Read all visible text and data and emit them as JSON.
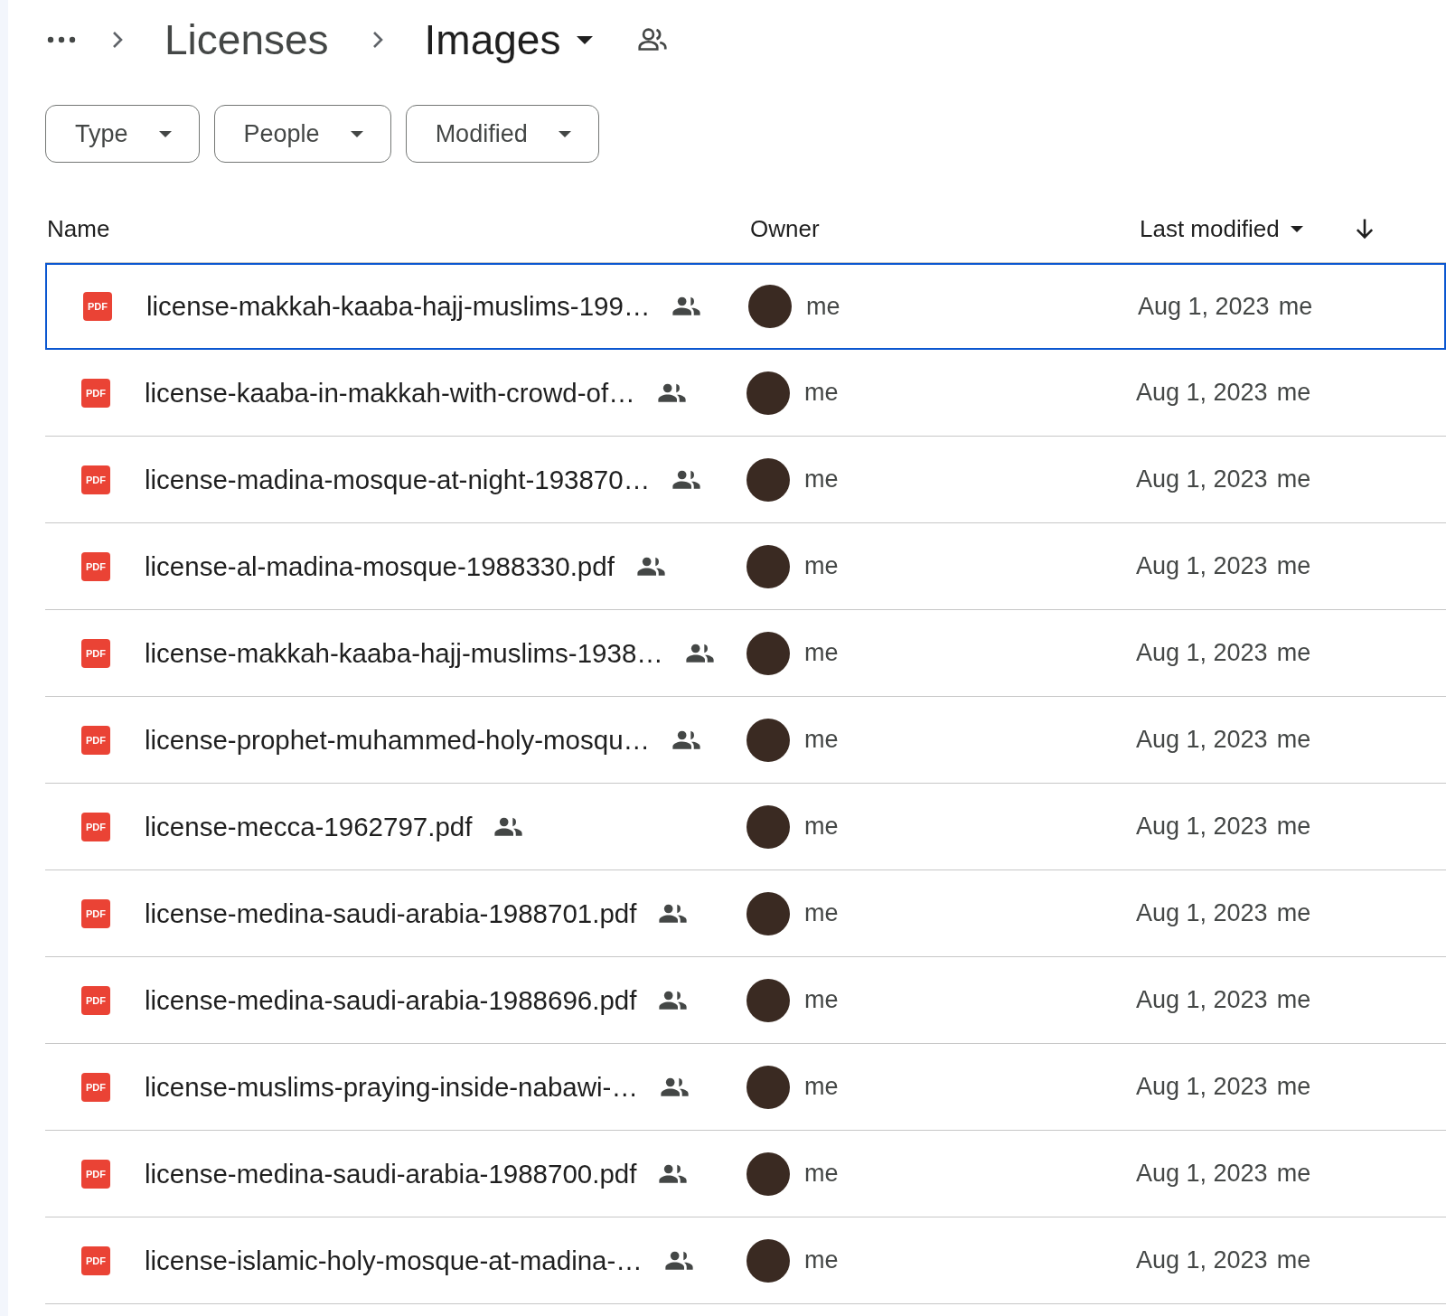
{
  "breadcrumb": {
    "items": [
      {
        "label": "Licenses"
      },
      {
        "label": "Images"
      }
    ]
  },
  "filters": [
    {
      "label": "Type"
    },
    {
      "label": "People"
    },
    {
      "label": "Modified"
    }
  ],
  "table": {
    "columns": [
      {
        "label": "Name"
      },
      {
        "label": "Owner"
      },
      {
        "label": "Last modified"
      }
    ],
    "rows": [
      {
        "badge": "PDF",
        "name": "license-makkah-kaaba-hajj-muslims-199…",
        "owner": "me",
        "modified": "Aug 1, 2023",
        "modified_by": "me",
        "selected": true
      },
      {
        "badge": "PDF",
        "name": "license-kaaba-in-makkah-with-crowd-of…",
        "owner": "me",
        "modified": "Aug 1, 2023",
        "modified_by": "me",
        "selected": false
      },
      {
        "badge": "PDF",
        "name": "license-madina-mosque-at-night-193870…",
        "owner": "me",
        "modified": "Aug 1, 2023",
        "modified_by": "me",
        "selected": false
      },
      {
        "badge": "PDF",
        "name": "license-al-madina-mosque-1988330.pdf",
        "owner": "me",
        "modified": "Aug 1, 2023",
        "modified_by": "me",
        "selected": false
      },
      {
        "badge": "PDF",
        "name": "license-makkah-kaaba-hajj-muslims-1938…",
        "owner": "me",
        "modified": "Aug 1, 2023",
        "modified_by": "me",
        "selected": false
      },
      {
        "badge": "PDF",
        "name": "license-prophet-muhammed-holy-mosqu…",
        "owner": "me",
        "modified": "Aug 1, 2023",
        "modified_by": "me",
        "selected": false
      },
      {
        "badge": "PDF",
        "name": "license-mecca-1962797.pdf",
        "owner": "me",
        "modified": "Aug 1, 2023",
        "modified_by": "me",
        "selected": false
      },
      {
        "badge": "PDF",
        "name": "license-medina-saudi-arabia-1988701.pdf",
        "owner": "me",
        "modified": "Aug 1, 2023",
        "modified_by": "me",
        "selected": false
      },
      {
        "badge": "PDF",
        "name": "license-medina-saudi-arabia-1988696.pdf",
        "owner": "me",
        "modified": "Aug 1, 2023",
        "modified_by": "me",
        "selected": false
      },
      {
        "badge": "PDF",
        "name": "license-muslims-praying-inside-nabawi-…",
        "owner": "me",
        "modified": "Aug 1, 2023",
        "modified_by": "me",
        "selected": false
      },
      {
        "badge": "PDF",
        "name": "license-medina-saudi-arabia-1988700.pdf",
        "owner": "me",
        "modified": "Aug 1, 2023",
        "modified_by": "me",
        "selected": false
      },
      {
        "badge": "PDF",
        "name": "license-islamic-holy-mosque-at-madina-…",
        "owner": "me",
        "modified": "Aug 1, 2023",
        "modified_by": "me",
        "selected": false
      }
    ]
  }
}
